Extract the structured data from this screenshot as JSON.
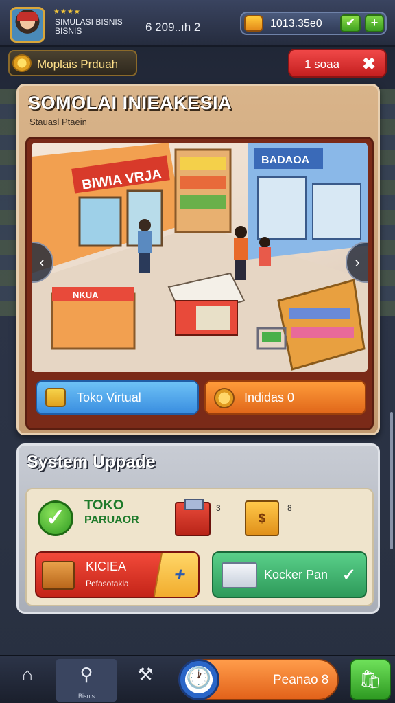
{
  "header": {
    "stars": "★★★★",
    "player_title": "SIMULASI BISNIS BISNIS",
    "score": "6 209..ıh 2",
    "coins": "1013.35e0",
    "confirm_icon": "check-icon",
    "add_icon": "plus-icon"
  },
  "subbar": {
    "mode_label": "Moplais Prduah",
    "close_label": "1 soaa",
    "close_icon": "close-icon"
  },
  "main_card": {
    "title": "SOMOLAI INIEAKESIA",
    "subtitle": "Stauasl Ptaein",
    "scene_signs": {
      "left_store": "BIWIA VRJA",
      "right_store": "BADAOA",
      "counter": "NKUA"
    },
    "left_button": "Toko Virtual",
    "right_button": "Indidas 0"
  },
  "system_panel": {
    "title": "System Uppade",
    "toko_line1": "TOKO",
    "toko_line2": "PARUAOR",
    "red_box_count": "3",
    "gold_box_count": "8",
    "gold_box_mark": "$",
    "kirim_title": "KICIEA",
    "kirim_sub": "Pefasotakla",
    "kocker_label": "Kocker Pan"
  },
  "bottom_nav": {
    "map_sub": "Bisnis",
    "timer_label": "Peanao 8"
  },
  "colors": {
    "accent_orange": "#e2621a",
    "accent_blue": "#3a8ee0",
    "accent_green": "#2e9a5a",
    "accent_red": "#c42418"
  }
}
